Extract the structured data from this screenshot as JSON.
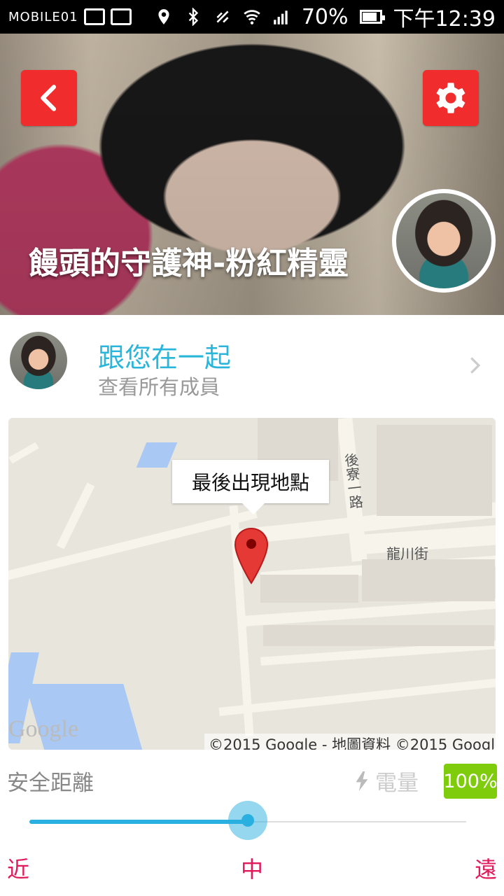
{
  "status_bar": {
    "logo": "MOBILE01",
    "battery_percent_label": "70%",
    "time": "下午12:39"
  },
  "hero": {
    "title": "饅頭的守護神-粉紅精靈"
  },
  "members": {
    "title": "跟您在一起",
    "subtitle": "查看所有成員"
  },
  "map": {
    "callout": "最後出現地點",
    "street_1": "後寮一路",
    "street_2": "龍川街",
    "google_logo": "Google",
    "credit": "©2015 Google - 地圖資料 ©2015 Googl"
  },
  "safety": {
    "label": "安全距離",
    "battery_label": "電量",
    "battery_value": "100%",
    "distance_level": 0.5,
    "range": {
      "near": "近",
      "mid": "中",
      "far": "遠"
    }
  },
  "colors": {
    "accent": "#2ab0e0",
    "danger": "#f02c2c",
    "range_text": "#e11a5b",
    "battery_green": "#7fcc0c"
  },
  "icons": {
    "back": "chevron-left-icon",
    "settings": "gear-icon",
    "chevron": "chevron-right-icon",
    "pin": "map-pin-icon",
    "bolt": "bolt-icon"
  }
}
